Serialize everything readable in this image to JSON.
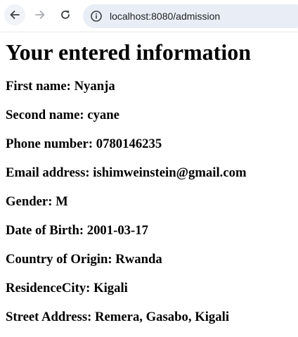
{
  "browser": {
    "url": "localhost:8080/admission"
  },
  "page": {
    "heading": "Your entered information",
    "fields": [
      {
        "label": "First name:",
        "value": "Nyanja"
      },
      {
        "label": "Second name:",
        "value": "cyane"
      },
      {
        "label": "Phone number:",
        "value": "0780146235"
      },
      {
        "label": "Email address:",
        "value": "ishimweinstein@gmail.com"
      },
      {
        "label": "Gender:",
        "value": "M"
      },
      {
        "label": "Date of Birth:",
        "value": "2001-03-17"
      },
      {
        "label": "Country of Origin:",
        "value": "Rwanda"
      },
      {
        "label": "ResidenceCity:",
        "value": "Kigali"
      },
      {
        "label": "Street Address:",
        "value": "Remera, Gasabo, Kigali"
      }
    ]
  },
  "icons": {
    "back": "arrow-left-icon",
    "forward": "arrow-right-icon",
    "reload": "reload-icon",
    "site_info": "info-circle-icon"
  },
  "colors": {
    "toolbar_bg": "#ffffff",
    "omnibox_bg": "#e9eef6",
    "icon_active": "#3c4043",
    "icon_disabled": "#a8abb0"
  }
}
